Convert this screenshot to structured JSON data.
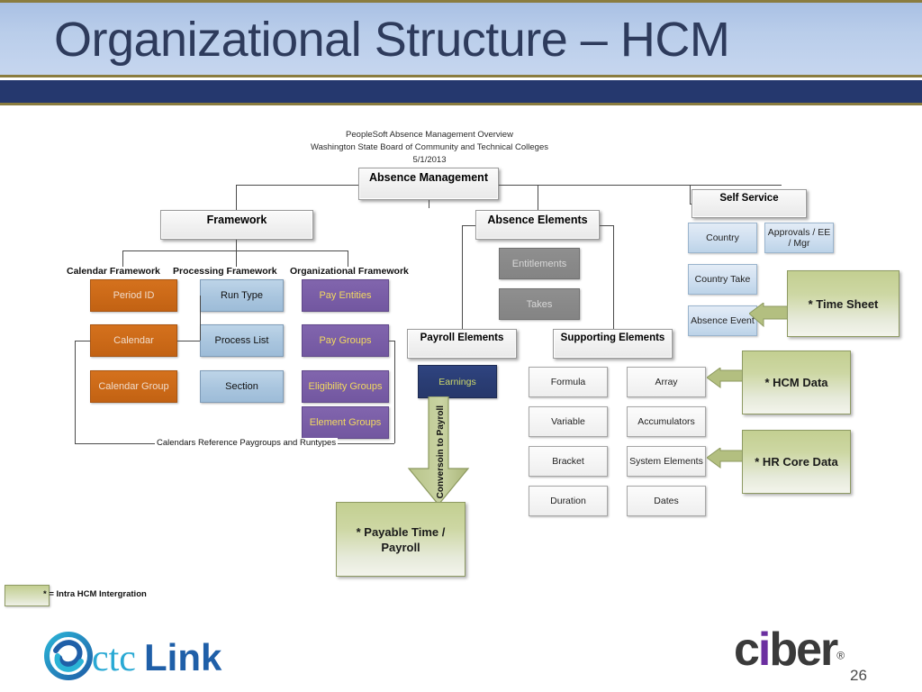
{
  "slide": {
    "title": "Organizational Structure – HCM",
    "slide_number": "26"
  },
  "diagram": {
    "header_lines": [
      "PeopleSoft Absence Management Overview",
      "Washington State Board of Community and Technical Colleges",
      "5/1/2013"
    ],
    "root": "Absence Management",
    "branches": {
      "framework": "Framework",
      "absence_elements": "Absence Elements",
      "self_service": "Self Service"
    },
    "framework": {
      "captions": {
        "calendar": "Calendar Framework",
        "processing": "Processing Framework",
        "organizational": "Organizational Framework"
      },
      "calendar_items": [
        "Period ID",
        "Calendar",
        "Calendar Group"
      ],
      "processing_items": [
        "Run Type",
        "Process List",
        "Section"
      ],
      "organizational_items": [
        "Pay Entities",
        "Pay Groups",
        "Eligibility Groups",
        "Element Groups"
      ],
      "footnote": "Calendars Reference Paygroups and Runtypes"
    },
    "absence_elements": {
      "items": [
        "Entitlements",
        "Takes"
      ],
      "payroll_elements": {
        "title": "Payroll Elements",
        "items": [
          "Earnings"
        ],
        "arrow_label": "Conversoin to Payroll",
        "target": "* Payable Time / Payroll"
      },
      "supporting_elements": {
        "title": "Supporting Elements",
        "column_left": [
          "Formula",
          "Variable",
          "Bracket",
          "Duration"
        ],
        "column_right": [
          "Array",
          "Accumulators",
          "System Elements",
          "Dates"
        ]
      }
    },
    "self_service": {
      "items": [
        "Country",
        "Approvals / EE / Mgr",
        "Country Take",
        "Absence Event"
      ]
    },
    "integrations": [
      "* Time Sheet",
      "* HCM Data",
      "* HR Core Data"
    ],
    "legend": "* = Intra HCM Intergration"
  },
  "logos": {
    "ctclink_ctc": "ctc",
    "ctclink_link": "Link",
    "ciber_c": "c",
    "ciber_i": "i",
    "ciber_ber": "ber",
    "ciber_reg": "®"
  },
  "colors": {
    "title_band": "#b9cdea",
    "title_text": "#2e3b5c",
    "band_rule": "#8a7c3f",
    "navy_bar": "#25386e",
    "orange": "#cc6a18",
    "purple": "#7a5ea7",
    "light_blue": "#a9c5de",
    "gray": "#898989",
    "earnings_navy": "#2a3d74",
    "green": "#c3cf91",
    "arrow_green": "#b3bf80"
  }
}
